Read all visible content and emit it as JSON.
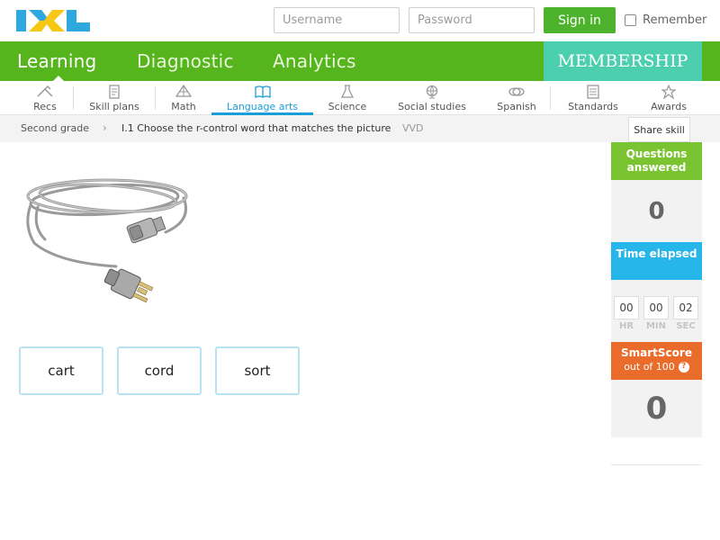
{
  "header": {
    "logo_text": "IXL",
    "username_placeholder": "Username",
    "password_placeholder": "Password",
    "signin_label": "Sign in",
    "remember_label": "Remember"
  },
  "main_nav": {
    "tabs": [
      {
        "label": "Learning",
        "active": true
      },
      {
        "label": "Diagnostic",
        "active": false
      },
      {
        "label": "Analytics",
        "active": false
      }
    ],
    "membership_label": "MEMBERSHIP"
  },
  "subject_nav": {
    "items": [
      {
        "label": "Recs",
        "icon": "recs-icon"
      },
      {
        "label": "Skill plans",
        "icon": "skill-plans-icon"
      },
      {
        "label": "Math",
        "icon": "math-icon"
      },
      {
        "label": "Language arts",
        "icon": "book-icon",
        "active": true
      },
      {
        "label": "Science",
        "icon": "flask-icon"
      },
      {
        "label": "Social studies",
        "icon": "globe-icon"
      },
      {
        "label": "Spanish",
        "icon": "spanish-icon"
      },
      {
        "label": "Standards",
        "icon": "standards-icon"
      },
      {
        "label": "Awards",
        "icon": "awards-icon"
      }
    ]
  },
  "breadcrumb": {
    "grade": "Second grade",
    "skill": "I.1 Choose the r-control word that matches the picture",
    "code": "VVD",
    "share_label": "Share skill"
  },
  "question": {
    "image": "power-cord-picture",
    "choices": [
      "cart",
      "cord",
      "sort"
    ]
  },
  "sidebar": {
    "questions_answered_label": "Questions answered",
    "questions_answered": "0",
    "time_elapsed_label": "Time elapsed",
    "time": {
      "hr": "00",
      "min": "00",
      "sec": "02"
    },
    "time_units": {
      "hr": "HR",
      "min": "MIN",
      "sec": "SEC"
    },
    "smartscore_label": "SmartScore",
    "smartscore_sub": "out of 100",
    "smartscore": "0"
  },
  "colors": {
    "green": "#56b41d",
    "membership": "#4bcfae",
    "blue": "#27b6ea",
    "orange": "#ea6c2b",
    "logo_blue": "#2fa7df",
    "logo_yellow": "#f6c714"
  }
}
